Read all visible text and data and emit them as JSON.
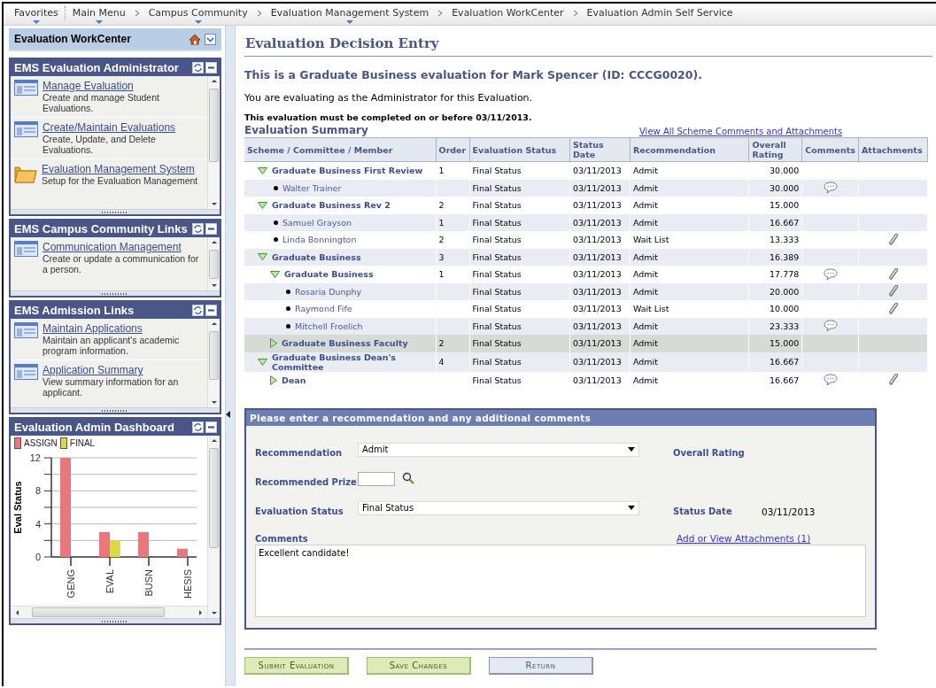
{
  "breadcrumb": [
    {
      "label": "Favorites",
      "menu": true
    },
    {
      "label": "Main Menu",
      "menu": true
    },
    {
      "label": "Campus Community",
      "menu": true
    },
    {
      "label": "Evaluation Management System",
      "menu": true
    },
    {
      "label": "Evaluation WorkCenter",
      "menu": false
    },
    {
      "label": "Evaluation Admin Self Service",
      "menu": false
    }
  ],
  "sidebar": {
    "title": "Evaluation WorkCenter",
    "pagelets": [
      {
        "title": "EMS Evaluation Administrator",
        "links": [
          {
            "title": "Manage Evaluation",
            "description": "Create and manage Student Evaluations.",
            "kind": "page"
          },
          {
            "title": "Create/Maintain Evaluations",
            "description": "Create, Update, and Delete Evaluations.",
            "kind": "page"
          },
          {
            "title": "Evaluation Management System",
            "description": "Setup for the Evaluation Management",
            "kind": "folder"
          }
        ]
      },
      {
        "title": "EMS Campus Community Links",
        "links": [
          {
            "title": "Communication Management",
            "description": "Create or update a communication for a person.",
            "kind": "page"
          }
        ]
      },
      {
        "title": "EMS Admission Links",
        "links": [
          {
            "title": "Maintain Applications",
            "description": "Maintain an applicant's academic program information.",
            "kind": "page"
          },
          {
            "title": "Application Summary",
            "description": "View summary information for an applicant.",
            "kind": "page"
          }
        ]
      },
      {
        "title": "Evaluation Admin Dashboard",
        "chart_data": {
          "type": "bar",
          "legend": "top",
          "ylabel": "Eval Status",
          "categories": [
            "GENG",
            "EVAL",
            "BUSN",
            "HESIS"
          ],
          "ylim": [
            0,
            12
          ],
          "yticks": [
            0,
            4,
            8,
            12
          ],
          "series": [
            {
              "name": "ASSIGN",
              "color": "#e9777d",
              "values": [
                12,
                3,
                3,
                1
              ]
            },
            {
              "name": "FINAL",
              "color": "#ddd845",
              "values": [
                null,
                2,
                null,
                null
              ]
            }
          ]
        }
      }
    ]
  },
  "main": {
    "title": "Evaluation Decision Entry",
    "heading": "This is a Graduate Business evaluation for Mark Spencer (ID: CCCG0020).",
    "intro": "You are evaluating as the Administrator for this Evaluation.",
    "deadline": "This evaluation must be completed on or before 03/11/2013.",
    "summary": {
      "title": "Evaluation Summary",
      "link": "View All Scheme Comments and Attachments",
      "columns": [
        "Scheme / Committee / Member",
        "Order",
        "Evaluation Status",
        "Status Date",
        "Recommendation",
        "Overall Rating",
        "Comments",
        "Attachments"
      ],
      "rows": [
        {
          "name": "Graduate Business First Review",
          "kind": "group",
          "expanded": true,
          "selected": false,
          "order": "1",
          "status": "Final Status",
          "date": "03/11/2013",
          "recommendation": "Admit",
          "rating": "30.000",
          "comment": false,
          "attachment": false,
          "children": [
            {
              "name": "Walter Trainer",
              "kind": "member",
              "selected": false,
              "status": "Final Status",
              "date": "03/11/2013",
              "recommendation": "Admit",
              "rating": "30.000",
              "comment": true,
              "attachment": false
            }
          ]
        },
        {
          "name": "Graduate Business Rev 2",
          "kind": "group",
          "expanded": true,
          "selected": false,
          "order": "2",
          "status": "Final Status",
          "date": "03/11/2013",
          "recommendation": "Admit",
          "rating": "15.000",
          "comment": false,
          "attachment": false,
          "children": [
            {
              "name": "Samuel Grayson",
              "kind": "member",
              "selected": false,
              "order": "1",
              "status": "Final Status",
              "date": "03/11/2013",
              "recommendation": "Admit",
              "rating": "16.667",
              "comment": false,
              "attachment": false
            },
            {
              "name": "Linda Bonnington",
              "kind": "member",
              "selected": false,
              "order": "2",
              "status": "Final Status",
              "date": "03/11/2013",
              "recommendation": "Wait List",
              "rating": "13.333",
              "comment": false,
              "attachment": true
            }
          ]
        },
        {
          "name": "Graduate Business",
          "kind": "group",
          "expanded": true,
          "selected": false,
          "order": "3",
          "status": "Final Status",
          "date": "03/11/2013",
          "recommendation": "Admit",
          "rating": "16.389",
          "comment": false,
          "attachment": false,
          "children": [
            {
              "name": "Graduate Business",
              "kind": "group",
              "expanded": true,
              "selected": false,
              "order": "1",
              "status": "Final Status",
              "date": "03/11/2013",
              "recommendation": "Admit",
              "rating": "17.778",
              "comment": true,
              "attachment": true,
              "children": [
                {
                  "name": "Rosaria Dunphy",
                  "kind": "member",
                  "selected": false,
                  "status": "Final Status",
                  "date": "03/11/2013",
                  "recommendation": "Admit",
                  "rating": "20.000",
                  "comment": false,
                  "attachment": true
                },
                {
                  "name": "Raymond Fife",
                  "kind": "member",
                  "selected": false,
                  "status": "Final Status",
                  "date": "03/11/2013",
                  "recommendation": "Wait List",
                  "rating": "10.000",
                  "comment": false,
                  "attachment": true
                },
                {
                  "name": "Mitchell Froelich",
                  "kind": "member",
                  "selected": false,
                  "status": "Final Status",
                  "date": "03/11/2013",
                  "recommendation": "Admit",
                  "rating": "23.333",
                  "comment": true,
                  "attachment": false
                }
              ]
            },
            {
              "name": "Graduate Business Faculty",
              "kind": "group",
              "expanded": false,
              "selected": true,
              "order": "2",
              "status": "Final Status",
              "date": "03/11/2013",
              "recommendation": "Admit",
              "rating": "15.000",
              "comment": false,
              "attachment": false
            }
          ]
        },
        {
          "name": "Graduate Business Dean's Committee",
          "kind": "group",
          "expanded": true,
          "selected": false,
          "order": "4",
          "status": "Final Status",
          "date": "03/11/2013",
          "recommendation": "Admit",
          "rating": "16.667",
          "comment": false,
          "attachment": false,
          "children": [
            {
              "name": "Dean",
              "kind": "group",
              "expanded": false,
              "selected": false,
              "status": "Final Status",
              "date": "03/11/2013",
              "recommendation": "Admit",
              "rating": "16.667",
              "comment": true,
              "attachment": true
            }
          ]
        }
      ]
    },
    "form": {
      "title": "Please enter a recommendation and any additional comments",
      "recommendation": {
        "label": "Recommendation",
        "value": "Admit"
      },
      "overall_rating": {
        "label": "Overall Rating"
      },
      "prize": {
        "label": "Recommended Prize"
      },
      "status": {
        "label": "Evaluation Status",
        "value": "Final Status"
      },
      "status_date": {
        "label": "Status Date",
        "value": "03/11/2013"
      },
      "comments": {
        "label": "Comments",
        "value": "Excellent candidate!"
      },
      "attachments_link": "Add or View Attachments (1)"
    },
    "buttons": [
      {
        "label": "Submit Evaluation",
        "kind": "primary"
      },
      {
        "label": "Save Changes",
        "kind": "primary"
      },
      {
        "label": "Return",
        "kind": "secondary"
      }
    ]
  }
}
